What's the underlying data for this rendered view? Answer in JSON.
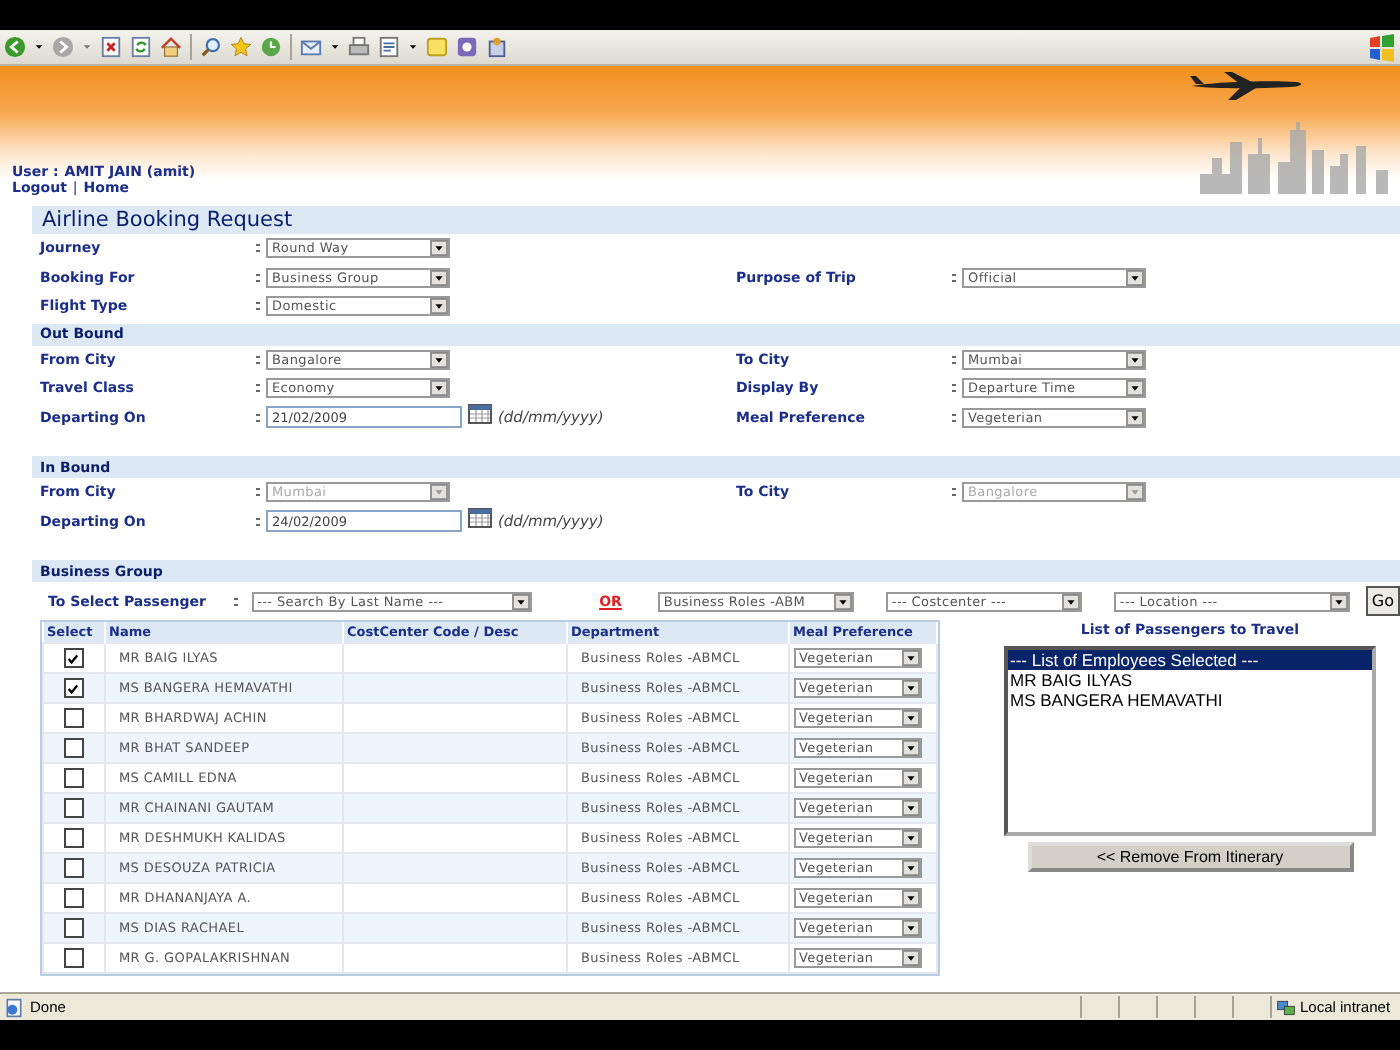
{
  "user": {
    "label": "User :",
    "name": "AMIT JAIN (amit)"
  },
  "links": [
    "Logout",
    "Home"
  ],
  "link_separator": "|",
  "title": "Airline Booking Request",
  "sections": [
    {
      "rows": [
        {
          "left": {
            "kind": "select",
            "label": "Journey",
            "value": "Round Way",
            "disabled": false
          }
        },
        {
          "left": {
            "kind": "select",
            "label": "Booking For",
            "value": "Business Group",
            "disabled": false
          },
          "right": {
            "kind": "select",
            "label": "Purpose of Trip",
            "value": "Official",
            "disabled": false
          }
        },
        {
          "left": {
            "kind": "select",
            "label": "Flight Type",
            "value": "Domestic",
            "disabled": false
          }
        }
      ]
    },
    {
      "header": "Out Bound",
      "rows": [
        {
          "left": {
            "kind": "select",
            "label": "From City",
            "value": "Bangalore",
            "disabled": false
          },
          "right": {
            "kind": "select",
            "label": "To City",
            "value": "Mumbai",
            "disabled": false
          }
        },
        {
          "left": {
            "kind": "select",
            "label": "Travel Class",
            "value": "Economy",
            "disabled": false
          },
          "right": {
            "kind": "select",
            "label": "Display By",
            "value": "Departure Time",
            "disabled": false
          }
        },
        {
          "left": {
            "kind": "date",
            "label": "Departing On",
            "value": "21/02/2009",
            "format": "(dd/mm/yyyy)"
          },
          "right": {
            "kind": "select",
            "label": "Meal Preference",
            "value": "Vegeterian",
            "disabled": false
          }
        }
      ]
    },
    {
      "header": "In Bound",
      "rows": [
        {
          "left": {
            "kind": "select",
            "label": "From City",
            "value": "Mumbai",
            "disabled": true
          },
          "right": {
            "kind": "select",
            "label": "To City",
            "value": "Bangalore",
            "disabled": true
          }
        },
        {
          "left": {
            "kind": "date",
            "label": "Departing On",
            "value": "24/02/2009",
            "format": "(dd/mm/yyyy)"
          }
        }
      ]
    },
    {
      "header": "Business Group"
    }
  ],
  "passenger_filter": {
    "label": "To Select Passenger",
    "search": "--- Search By Last Name ---",
    "or": "OR",
    "filters": [
      "Business Roles -ABM",
      "--- Costcenter ---",
      "--- Location ---"
    ],
    "go": "Go"
  },
  "table": {
    "columns": [
      "Select",
      "Name",
      "CostCenter Code / Desc",
      "Department",
      "Meal Preference"
    ],
    "rows": [
      {
        "checked": true,
        "name": "MR BAIG ILYAS",
        "department": "Business Roles -ABMCL",
        "meal": "Vegeterian"
      },
      {
        "checked": true,
        "name": "MS BANGERA HEMAVATHI",
        "department": "Business Roles -ABMCL",
        "meal": "Vegeterian"
      },
      {
        "checked": false,
        "name": "MR BHARDWAJ ACHIN",
        "department": "Business Roles -ABMCL",
        "meal": "Vegeterian"
      },
      {
        "checked": false,
        "name": "MR BHAT SANDEEP",
        "department": "Business Roles -ABMCL",
        "meal": "Vegeterian"
      },
      {
        "checked": false,
        "name": "MS CAMILL EDNA",
        "department": "Business Roles -ABMCL",
        "meal": "Vegeterian"
      },
      {
        "checked": false,
        "name": "MR CHAINANI GAUTAM",
        "department": "Business Roles -ABMCL",
        "meal": "Vegeterian"
      },
      {
        "checked": false,
        "name": "MR DESHMUKH KALIDAS",
        "department": "Business Roles -ABMCL",
        "meal": "Vegeterian"
      },
      {
        "checked": false,
        "name": "MS DESOUZA PATRICIA",
        "department": "Business Roles -ABMCL",
        "meal": "Vegeterian"
      },
      {
        "checked": false,
        "name": "MR DHANANJAYA A.",
        "department": "Business Roles -ABMCL",
        "meal": "Vegeterian"
      },
      {
        "checked": false,
        "name": "MS DIAS RACHAEL",
        "department": "Business Roles -ABMCL",
        "meal": "Vegeterian"
      },
      {
        "checked": false,
        "name": "MR G. GOPALAKRISHNAN",
        "department": "Business Roles -ABMCL",
        "meal": "Vegeterian"
      }
    ]
  },
  "passengers_panel": {
    "title": "List of Passengers to Travel",
    "items": [
      {
        "text": "--- List of Employees Selected ---",
        "selected": true
      },
      {
        "text": "MR BAIG ILYAS",
        "selected": false
      },
      {
        "text": "MS BANGERA HEMAVATHI",
        "selected": false
      }
    ],
    "button": "<< Remove From Itinerary"
  },
  "status_bar": {
    "text": "Done",
    "zone": "Local intranet"
  }
}
